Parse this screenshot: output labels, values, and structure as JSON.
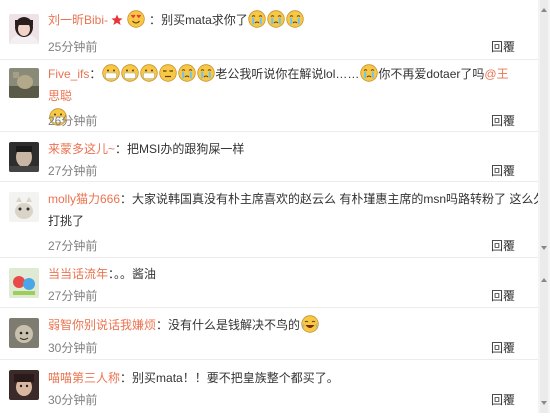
{
  "comments": [
    {
      "user": "刘一昕Bibi-",
      "text": "别买mata求你了",
      "time": "25分钟前",
      "reply": "回覆"
    },
    {
      "user": "Five_ifs",
      "text_a": "老公我听说你在解说lol……",
      "text_b": "你不再爱dotaer了吗",
      "mention": "@王思聪",
      "time": "26分钟前",
      "reply": "回覆"
    },
    {
      "user": "来蒙多这儿~",
      "text": "把MSI办的跟狗屎一样",
      "time": "27分钟前",
      "reply": "回覆"
    },
    {
      "user": "molly猫力666",
      "text": "大家说韩国真没有朴主席喜欢的赵云么 有朴瑾惠主席的msn吗路转粉了 这么久打挑了",
      "time": "27分钟前",
      "reply": "回覆"
    },
    {
      "user": "当当话流年",
      "text": "。。酱油",
      "time": "27分钟前",
      "reply": "回覆"
    },
    {
      "user": "弱智你别说话我嫌烦",
      "text": "没有什么是钱解决不鸟的",
      "time": "30分钟前",
      "reply": "回覆"
    },
    {
      "user": "喵喵第三人称",
      "text": "别买mata！！要不把皇族整个都买了。",
      "time": "30分钟前",
      "reply": "回覆"
    }
  ],
  "colors": {
    "username": "#eb7350",
    "time": "#808080",
    "text": "#333333"
  }
}
